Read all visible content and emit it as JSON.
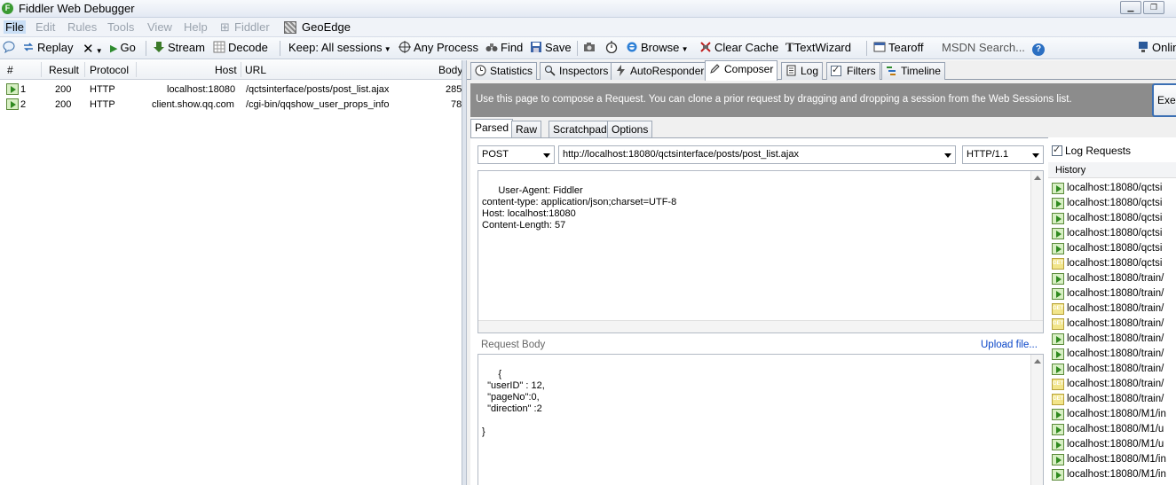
{
  "window": {
    "title": "Fiddler Web Debugger"
  },
  "menu": [
    "File",
    "Edit",
    "Rules",
    "Tools",
    "View",
    "Help",
    "Fiddler",
    "GeoEdge"
  ],
  "toolbar": {
    "replay": "Replay",
    "go": "Go",
    "stream": "Stream",
    "decode": "Decode",
    "keep": "Keep: All sessions",
    "any_process": "Any Process",
    "find": "Find",
    "save": "Save",
    "browse": "Browse",
    "clear_cache": "Clear Cache",
    "text_wizard": "TextWizard",
    "tearoff": "Tearoff",
    "msdn_search": "MSDN Search...",
    "online": "Online"
  },
  "sessions": {
    "columns": [
      "#",
      "Result",
      "Protocol",
      "Host",
      "URL",
      "Body"
    ],
    "rows": [
      {
        "num": "1",
        "result": "200",
        "protocol": "HTTP",
        "host": "localhost:18080",
        "url": "/qctsinterface/posts/post_list.ajax",
        "body": "285"
      },
      {
        "num": "2",
        "result": "200",
        "protocol": "HTTP",
        "host": "client.show.qq.com",
        "url": "/cgi-bin/qqshow_user_props_info",
        "body": "78"
      }
    ]
  },
  "tabs": [
    "Statistics",
    "Inspectors",
    "AutoResponder",
    "Composer",
    "Log",
    "Filters",
    "Timeline"
  ],
  "composer": {
    "banner": "Use this page to compose a Request. You can clone a prior request by dragging and dropping a session from the Web Sessions list.",
    "execute": "Exe",
    "subtabs": [
      "Parsed",
      "Raw",
      "Scratchpad",
      "Options"
    ],
    "method": "POST",
    "url": "http://localhost:18080/qctsinterface/posts/post_list.ajax",
    "version": "HTTP/1.1",
    "headers": "User-Agent: Fiddler\ncontent-type: application/json;charset=UTF-8\nHost: localhost:18080\nContent-Length: 57",
    "request_body_label": "Request Body",
    "upload_file": "Upload file...",
    "body": "{\n  \"userID\" : 12,\n  \"pageNo\":0,\n  \"direction\" :2\n\n}"
  },
  "history": {
    "log_requests": "Log Requests",
    "header": "History",
    "items": [
      {
        "text": "localhost:18080/qctsi",
        "get": false
      },
      {
        "text": "localhost:18080/qctsi",
        "get": false
      },
      {
        "text": "localhost:18080/qctsi",
        "get": false
      },
      {
        "text": "localhost:18080/qctsi",
        "get": false
      },
      {
        "text": "localhost:18080/qctsi",
        "get": false
      },
      {
        "text": "localhost:18080/qctsi",
        "get": true
      },
      {
        "text": "localhost:18080/train/",
        "get": false
      },
      {
        "text": "localhost:18080/train/",
        "get": false
      },
      {
        "text": "localhost:18080/train/",
        "get": true
      },
      {
        "text": "localhost:18080/train/",
        "get": true
      },
      {
        "text": "localhost:18080/train/",
        "get": false
      },
      {
        "text": "localhost:18080/train/",
        "get": false
      },
      {
        "text": "localhost:18080/train/",
        "get": false
      },
      {
        "text": "localhost:18080/train/",
        "get": true
      },
      {
        "text": "localhost:18080/train/",
        "get": true
      },
      {
        "text": "localhost:18080/M1/in",
        "get": false
      },
      {
        "text": "localhost:18080/M1/u",
        "get": false
      },
      {
        "text": "localhost:18080/M1/u",
        "get": false
      },
      {
        "text": "localhost:18080/M1/in",
        "get": false
      },
      {
        "text": "localhost:18080/M1/in",
        "get": false
      }
    ]
  }
}
